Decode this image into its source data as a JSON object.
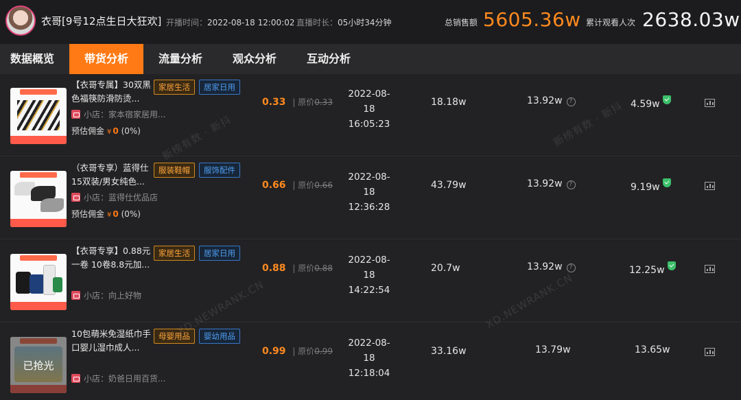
{
  "header": {
    "anchor_name": "衣哥[9号12点生日大狂欢]",
    "start_label": "开播时间：",
    "start_value": "2022-08-18 12:00:02",
    "duration_label": "直播时长：",
    "duration_value": "05小时34分钟",
    "sales_label": "总销售额",
    "sales_value": "5605.36w",
    "views_label": "累计观看人次",
    "views_value": "2638.03w"
  },
  "tabs": [
    {
      "label": "数据概览",
      "active": false
    },
    {
      "label": "带货分析",
      "active": true
    },
    {
      "label": "流量分析",
      "active": false
    },
    {
      "label": "观众分析",
      "active": false
    },
    {
      "label": "互动分析",
      "active": false
    }
  ],
  "common": {
    "orig_price_label": "原价",
    "commission_label": "预估佣金",
    "currency": "¥",
    "chart_icon": "bar-chart-icon",
    "help_icon": "question-circle-icon",
    "help_glyph": "?",
    "verified_icon": "shield-check-icon"
  },
  "products": [
    {
      "title": "【衣哥专属】30双黑色福筷防滑防烫...",
      "category": "家居生活",
      "subcategory": "居家日用",
      "shop": "小店：家本宿家居用...",
      "commission": "0",
      "commission_rate": "(0%)",
      "price": "0.33",
      "orig_price": "0.33",
      "date": "2022-08-18",
      "time": "16:05:23",
      "sold": "18.18w",
      "stock": "13.92w",
      "gmv": "4.59w",
      "verified": true,
      "sold_out": false
    },
    {
      "title": "（衣哥专享）蓝得仕15双装/男女纯色...",
      "category": "服装鞋帽",
      "subcategory": "服饰配件",
      "shop": "小店：蓝得仕优品店",
      "commission": "0",
      "commission_rate": "(0%)",
      "price": "0.66",
      "orig_price": "0.66",
      "date": "2022-08-18",
      "time": "12:36:28",
      "sold": "43.79w",
      "stock": "13.92w",
      "gmv": "9.19w",
      "verified": true,
      "sold_out": false
    },
    {
      "title": "【衣哥专享】0.88元一卷 10卷8.8元加...",
      "category": "家居生活",
      "subcategory": "居家日用",
      "shop": "小店：向上好物",
      "commission": "",
      "commission_rate": "",
      "price": "0.88",
      "orig_price": "0.88",
      "date": "2022-08-18",
      "time": "14:22:54",
      "sold": "20.7w",
      "stock": "13.92w",
      "gmv": "12.25w",
      "verified": true,
      "sold_out": false
    },
    {
      "title": "10包萌米免湿纸巾手口婴儿湿巾成人...",
      "category": "母婴用品",
      "subcategory": "婴幼用品",
      "shop": "小店：奶爸日用百货...",
      "commission": "",
      "commission_rate": "",
      "price": "0.99",
      "orig_price": "0.99",
      "date": "2022-08-18",
      "time": "12:18:04",
      "sold": "33.16w",
      "stock": "13.79w",
      "gmv": "13.65w",
      "verified": false,
      "sold_out": true,
      "sold_out_label": "已抢光"
    }
  ],
  "watermarks": [
    "新榜有数 · 新抖",
    "XD.NEWRANK.CN"
  ]
}
